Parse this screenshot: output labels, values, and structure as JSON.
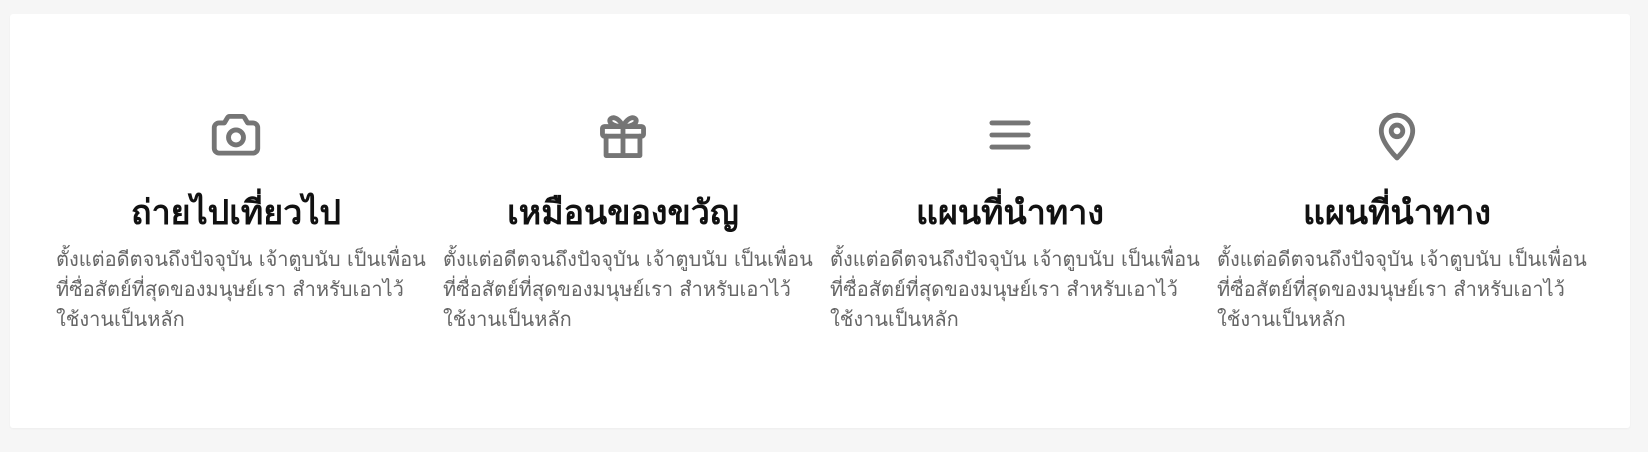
{
  "features": [
    {
      "icon": "camera-icon",
      "title": "ถ่ายไปเที่ยวไป",
      "description": "ตั้งแต่อดีตจนถึงปัจจุบัน เจ้าตูบนับ เป็นเพื่อนที่ซื่อสัตย์ที่สุดของมนุษย์เรา สำหรับเอาไว้ใช้งานเป็นหลัก"
    },
    {
      "icon": "gift-icon",
      "title": "เหมือนของขวัญ",
      "description": "ตั้งแต่อดีตจนถึงปัจจุบัน เจ้าตูบนับ เป็นเพื่อนที่ซื่อสัตย์ที่สุดของมนุษย์เรา สำหรับเอาไว้ใช้งานเป็นหลัก"
    },
    {
      "icon": "menu-icon",
      "title": "แผนที่นำทาง",
      "description": "ตั้งแต่อดีตจนถึงปัจจุบัน เจ้าตูบนับ เป็นเพื่อนที่ซื่อสัตย์ที่สุดของมนุษย์เรา สำหรับเอาไว้ใช้งานเป็นหลัก"
    },
    {
      "icon": "map-pin-icon",
      "title": "แผนที่นำทาง",
      "description": "ตั้งแต่อดีตจนถึงปัจจุบัน เจ้าตูบนับ เป็นเพื่อนที่ซื่อสัตย์ที่สุดของมนุษย์เรา สำหรับเอาไว้ใช้งานเป็นหลัก"
    }
  ],
  "colors": {
    "background": "#f6f6f6",
    "card": "#ffffff",
    "icon": "#757575",
    "title": "#111111",
    "description": "#666666"
  }
}
